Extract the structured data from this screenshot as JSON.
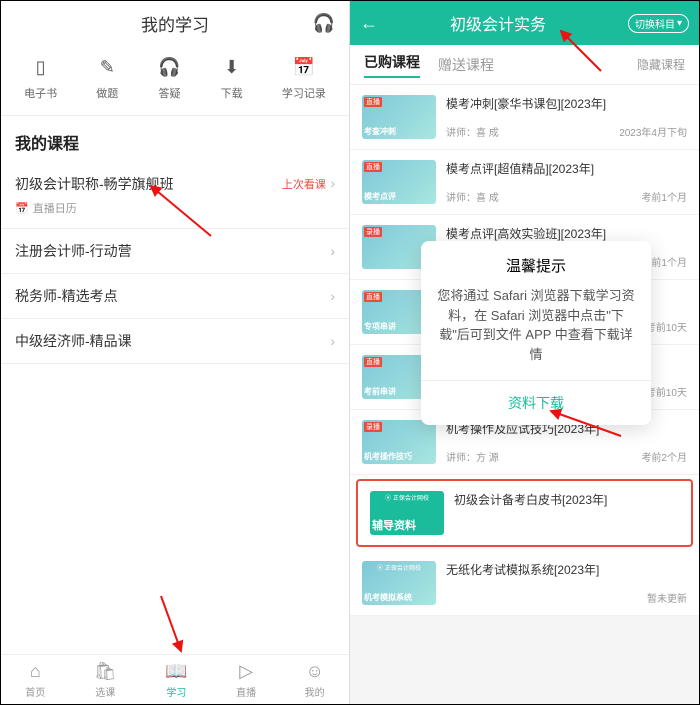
{
  "left": {
    "title": "我的学习",
    "icons": [
      {
        "label": "电子书",
        "glyph": "▯",
        "name": "ebook"
      },
      {
        "label": "做题",
        "glyph": "✎",
        "name": "exercise"
      },
      {
        "label": "答疑",
        "glyph": "🎧",
        "name": "qa"
      },
      {
        "label": "下载",
        "glyph": "⬇",
        "name": "download"
      },
      {
        "label": "学习记录",
        "glyph": "📅",
        "name": "record"
      }
    ],
    "section": "我的课程",
    "courses": [
      {
        "name": "初级会计职称-畅学旗舰班",
        "lastWatch": "上次看课",
        "sub": "直播日历"
      },
      {
        "name": "注册会计师-行动营"
      },
      {
        "name": "税务师-精选考点"
      },
      {
        "name": "中级经济师-精品课"
      }
    ],
    "tabs": [
      {
        "label": "首页",
        "glyph": "⌂"
      },
      {
        "label": "选课",
        "glyph": "🛍"
      },
      {
        "label": "学习",
        "glyph": "📖",
        "active": true
      },
      {
        "label": "直播",
        "glyph": "▷"
      },
      {
        "label": "我的",
        "glyph": "☺"
      }
    ]
  },
  "right": {
    "title": "初级会计实务",
    "switchLabel": "切换科目",
    "tabs": {
      "purchased": "已购课程",
      "free": "赠送课程",
      "hide": "隐藏课程"
    },
    "list": [
      {
        "tag": "直播",
        "strip": "考查冲刺",
        "title": "模考冲刺[豪华书课包][2023年]",
        "teacher": "讲师：喜 成",
        "time": "2023年4月下旬"
      },
      {
        "tag": "直播",
        "strip": "模考点评",
        "title": "模考点评[超值精品][2023年]",
        "teacher": "讲师：喜 成",
        "time": "考前1个月"
      },
      {
        "tag": "录播",
        "strip": "",
        "title": "模考点评[高效实验班][2023年]",
        "teacher": "",
        "time": "考前1个月"
      },
      {
        "tag": "直播",
        "strip": "专项串讲",
        "title": "",
        "teacher": "",
        "time": "考前10天"
      },
      {
        "tag": "直播",
        "strip": "考前串讲",
        "title": "",
        "teacher": "",
        "time": "考前10天"
      },
      {
        "tag": "录播",
        "strip": "机考操作技巧",
        "title": "机考操作及应试技巧[2023年]",
        "teacher": "讲师：方 源",
        "time": "考前2个月"
      },
      {
        "tag": "",
        "strip": "辅导资料",
        "title": "初级会计备考白皮书[2023年]",
        "highlight": true,
        "brand": "正保会计网校"
      },
      {
        "tag": "",
        "strip": "机考模拟系统",
        "title": "无纸化考试模拟系统[2023年]",
        "teacher": "",
        "time": "暂未更新",
        "brand": "正保会计网校"
      }
    ]
  },
  "modal": {
    "title": "温馨提示",
    "body": "您将通过 Safari 浏览器下载学习资料，在 Safari 浏览器中点击\"下载\"后可到文件 APP 中查看下载详情",
    "button": "资料下载"
  }
}
